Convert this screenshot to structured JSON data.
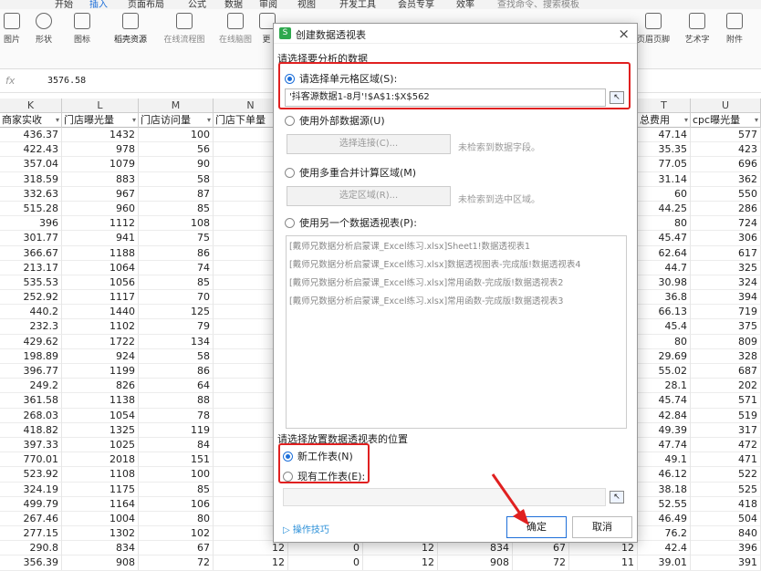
{
  "menubar": {
    "items": [
      "开始",
      "插入",
      "页面布局",
      "公式",
      "数据",
      "审阅",
      "视图",
      "开发工具",
      "会员专享",
      "效率",
      "查找命令、搜索模板"
    ]
  },
  "ribbon": {
    "items": [
      "图片",
      "形状",
      "图标",
      "稻壳资源",
      "在线流程图",
      "在线脑图",
      "更",
      "页眉页脚",
      "艺术字",
      "附件"
    ]
  },
  "formula": {
    "fx": "fx",
    "value": "3576.58"
  },
  "columns": {
    "letters": [
      "K",
      "L",
      "M",
      "N",
      "T",
      "U"
    ],
    "headers": [
      "商家实收",
      "门店曝光量",
      "门店访问量",
      "门店下单量",
      "总费用",
      "cpc曝光量"
    ]
  },
  "rows": [
    [
      "436.37",
      "1432",
      "100",
      "47.14",
      "577"
    ],
    [
      "422.43",
      "978",
      "56",
      "35.35",
      "423"
    ],
    [
      "357.04",
      "1079",
      "90",
      "77.05",
      "696"
    ],
    [
      "318.59",
      "883",
      "58",
      "31.14",
      "362"
    ],
    [
      "332.63",
      "967",
      "87",
      "60",
      "550"
    ],
    [
      "515.28",
      "960",
      "85",
      "44.25",
      "286"
    ],
    [
      "396",
      "1112",
      "108",
      "80",
      "724"
    ],
    [
      "301.77",
      "941",
      "75",
      "45.47",
      "306"
    ],
    [
      "366.67",
      "1188",
      "86",
      "62.64",
      "617"
    ],
    [
      "213.17",
      "1064",
      "74",
      "44.7",
      "325"
    ],
    [
      "535.53",
      "1056",
      "85",
      "30.98",
      "324"
    ],
    [
      "252.92",
      "1117",
      "70",
      "36.8",
      "394"
    ],
    [
      "440.2",
      "1440",
      "125",
      "66.13",
      "719"
    ],
    [
      "232.3",
      "1102",
      "79",
      "45.4",
      "375"
    ],
    [
      "429.62",
      "1722",
      "134",
      "80",
      "809"
    ],
    [
      "198.89",
      "924",
      "58",
      "29.69",
      "328"
    ],
    [
      "396.77",
      "1199",
      "86",
      "55.02",
      "687"
    ],
    [
      "249.2",
      "826",
      "64",
      "28.1",
      "202"
    ],
    [
      "361.58",
      "1138",
      "88",
      "45.74",
      "571"
    ],
    [
      "268.03",
      "1054",
      "78",
      "42.84",
      "519"
    ],
    [
      "418.82",
      "1325",
      "119",
      "49.39",
      "317"
    ],
    [
      "397.33",
      "1025",
      "84",
      "47.74",
      "472"
    ],
    [
      "770.01",
      "2018",
      "151",
      "49.1",
      "471"
    ],
    [
      "523.92",
      "1108",
      "100",
      "46.12",
      "522"
    ],
    [
      "324.19",
      "1175",
      "85",
      "38.18",
      "525"
    ],
    [
      "499.79",
      "1164",
      "106",
      "52.55",
      "418"
    ],
    [
      "267.46",
      "1004",
      "80",
      "46.49",
      "504"
    ],
    [
      "277.15",
      "1302",
      "102",
      "76.2",
      "840"
    ],
    [
      "290.8",
      "834",
      "67",
      "42.4",
      "396"
    ],
    [
      "356.39",
      "908",
      "72",
      "39.01",
      "391"
    ]
  ],
  "partial_rows": [
    [
      "12",
      "0",
      "12",
      "834",
      "67",
      "12"
    ],
    [
      "12",
      "0",
      "12",
      "908",
      "72",
      "11"
    ]
  ],
  "dialog": {
    "title": "创建数据透视表",
    "close": "×",
    "section1": "请选择要分析的数据",
    "opt_range": "请选择单元格区域(S):",
    "range_value": "'抖客源数据1-8月'!$A$1:$X$562",
    "opt_external": "使用外部数据源(U)",
    "btn_select_conn": "选择连接(C)...",
    "note_no_field": "未检索到数据字段。",
    "opt_multi": "使用多重合并计算区域(M)",
    "btn_select_area": "选定区域(R)...",
    "note_no_area": "未检索到选中区域。",
    "opt_other_pivot": "使用另一个数据透视表(P):",
    "pivot_list": [
      "[戴师兄数据分析启蒙课_Excel练习.xlsx]Sheet1!数据透视表1",
      "[戴师兄数据分析启蒙课_Excel练习.xlsx]数据透视图表-完成版!数据透视表4",
      "[戴师兄数据分析启蒙课_Excel练习.xlsx]常用函数-完成版!数据透视表2",
      "[戴师兄数据分析启蒙课_Excel练习.xlsx]常用函数-完成版!数据透视表3"
    ],
    "section2": "请选择放置数据透视表的位置",
    "opt_new": "新工作表(N)",
    "opt_exist": "现有工作表(E):",
    "tips": "操作技巧",
    "ok": "确定",
    "cancel": "取消"
  },
  "colors": {
    "accent": "#1e6fd9",
    "highlight": "#e02020",
    "logo": "#2da84d"
  }
}
